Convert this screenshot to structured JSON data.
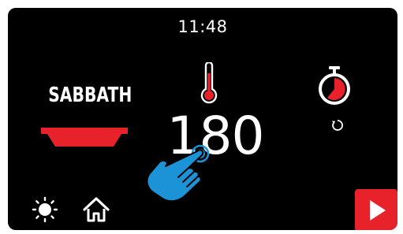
{
  "status_bar": {
    "time": "11:48"
  },
  "cooking_mode": {
    "label": "SABBATH",
    "icon": "oven-tray-icon"
  },
  "temperature": {
    "value": "180",
    "icon": "thermometer-icon"
  },
  "timer": {
    "icon": "stopwatch-icon",
    "reset_icon": "reset-arrow-icon"
  },
  "bottom_bar": {
    "light_icon": "sun-icon",
    "home_icon": "home-icon",
    "start_icon": "play-icon"
  },
  "gesture": {
    "icon": "tap-hand-icon"
  },
  "colors": {
    "background": "#000000",
    "accent": "#e8222a",
    "hand": "#1b93d6",
    "text": "#ffffff"
  }
}
